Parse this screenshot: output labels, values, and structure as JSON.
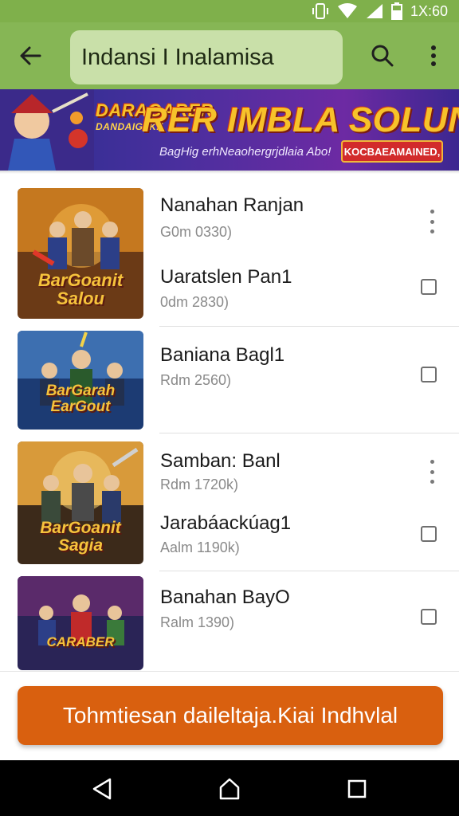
{
  "status_bar": {
    "time": "1X:60"
  },
  "app_bar": {
    "search_text": "Indansi I Inalamisa"
  },
  "banner": {
    "title_small": "DARAGARER",
    "title_tag": "DANDAIG IKE",
    "title_main": "RER IMBLA SOLUN",
    "subtitle": "BagHig erhNeaohergrjdlaia Abo!",
    "cta": "KOCBAEAMAINED,"
  },
  "list": {
    "items": [
      {
        "title": "Nanahan Ranjan",
        "subtitle": "G0m 0330)",
        "control": "menu",
        "thumb_caption": "BarGoanit Salou"
      },
      {
        "title": "Uaratslen Pan1",
        "subtitle": "0dm 2830)",
        "control": "checkbox"
      },
      {
        "title": "Baniana Bagl1",
        "subtitle": "Rdm 2560)",
        "control": "checkbox",
        "thumb_caption": "BarGarah EarGout"
      },
      {
        "title": "Samban: Banl",
        "subtitle": "Rdm 1720k)",
        "control": "menu",
        "thumb_caption": "BarGoanit Sagia"
      },
      {
        "title": "Jarabáackúag1",
        "subtitle": "Aalm 1190k)",
        "control": "checkbox"
      },
      {
        "title": "Banahan BayO",
        "subtitle": "Ralm 1390)",
        "control": "checkbox",
        "thumb_caption": "CARABER"
      }
    ]
  },
  "cta": {
    "label": "Tohmtiesan daileltaja.Kiai Indhvlal"
  },
  "colors": {
    "appbar": "#86b655",
    "statusbar": "#7fb04b",
    "cta": "#d9600f",
    "search": "#c9e0a9"
  },
  "icons": [
    "back-arrow-icon",
    "search-icon",
    "more-vert-icon",
    "nav-back-icon",
    "nav-home-icon",
    "nav-recents-icon"
  ]
}
